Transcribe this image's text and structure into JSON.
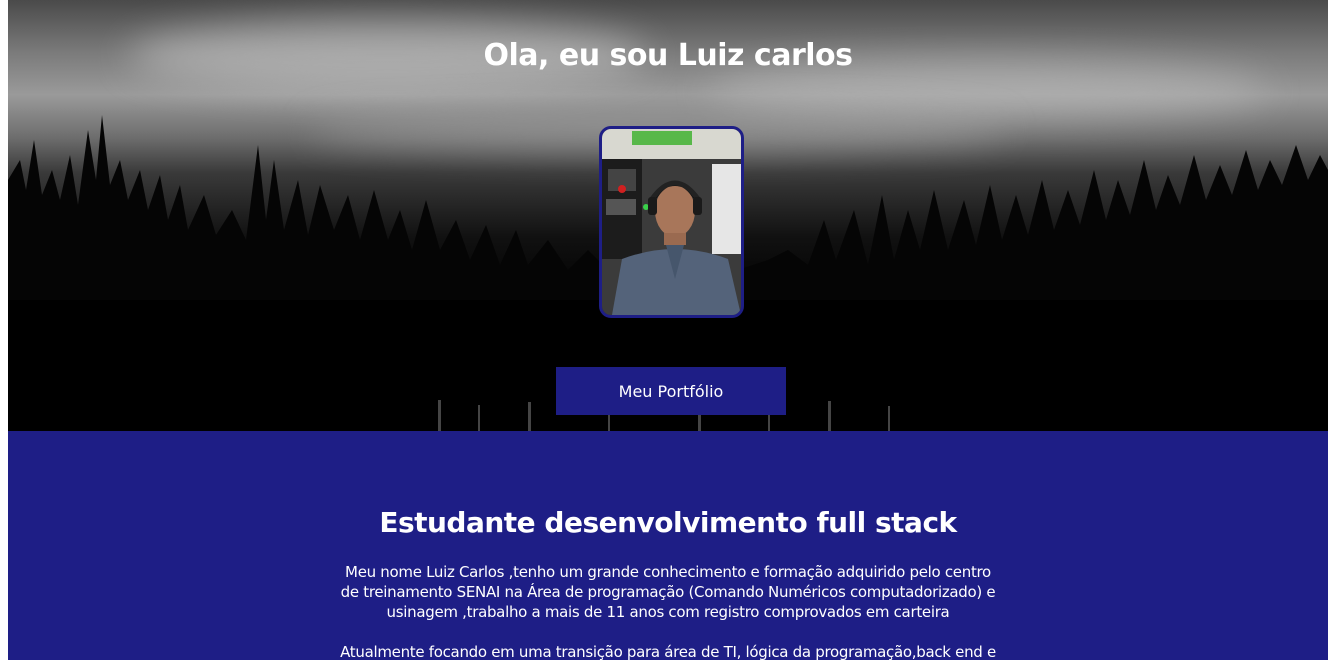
{
  "hero": {
    "title": "Ola, eu sou Luiz carlos",
    "button_label": "Meu Portfólio"
  },
  "about": {
    "title": "Estudante desenvolvimento full stack",
    "paragraph_1": "Meu nome Luiz Carlos ,tenho um grande conhecimento e formação adquirido pelo centro de treinamento SENAI na Área de programação (Comando Numéricos computadorizado) e usinagem ,trabalho a mais de 11 anos com registro comprovados em carteira",
    "paragraph_2": "Atualmente focando em uma transição para área de TI, lógica da programação,back end e"
  },
  "colors": {
    "accent": "#1e1e86",
    "text": "#ffffff",
    "hero_bg": "#000000"
  }
}
